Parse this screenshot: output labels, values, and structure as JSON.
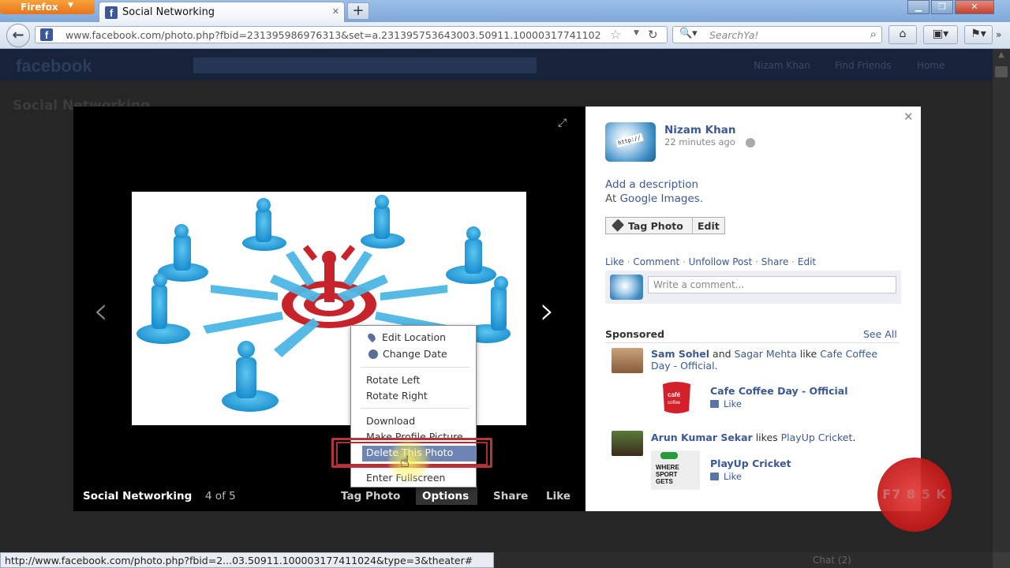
{
  "browser": {
    "app_button": "Firefox",
    "tab_title": "Social Networking",
    "url": "www.facebook.com/photo.php?fbid=231395986976313&set=a.231395753643003.50911.10000317741102",
    "search_placeholder": "SearchYa!",
    "status_url": "http://www.facebook.com/photo.php?fbid=2...03.50911.100003177411024&type=3&theater#"
  },
  "fb_background": {
    "logo": "facebook",
    "user_name": "Nizam Khan",
    "find_friends": "Find Friends",
    "home": "Home",
    "page_title": "Social Networking",
    "chat": "Chat (2)"
  },
  "theater": {
    "album_name": "Social Networking",
    "photo_count": "4 of 5",
    "actions": {
      "tag_photo": "Tag Photo",
      "options": "Options",
      "share": "Share",
      "like": "Like"
    },
    "menu": {
      "edit_location": "Edit Location",
      "change_date": "Change Date",
      "rotate_left": "Rotate Left",
      "rotate_right": "Rotate Right",
      "download": "Download",
      "make_profile_picture": "Make Profile Picture",
      "delete_photo": "Delete This Photo",
      "enter_fullscreen": "Enter Fullscreen"
    }
  },
  "panel": {
    "owner_name": "Nizam Khan",
    "posted_time": "22 minutes ago",
    "add_description": "Add a description",
    "at_prefix": "At ",
    "at_place": "Google Images.",
    "tag_photo_button": "Tag Photo",
    "edit_button": "Edit",
    "actions": [
      "Like",
      "Comment",
      "Unfollow Post",
      "Share",
      "Edit"
    ],
    "comment_placeholder": "Write a comment...",
    "sponsored_label": "Sponsored",
    "see_all": "See All",
    "sponsored": [
      {
        "people": "Sam Sohel",
        "and_text": " and ",
        "people2": "Sagar Mehta",
        "like_text": " like ",
        "page": "Cafe Coffee Day - Official",
        "page_end": ".",
        "ad_name": "Cafe Coffee Day - Official",
        "ad_like": "Like"
      },
      {
        "people": "Arun Kumar Sekar",
        "like_text": " likes ",
        "page": "PlayUp Cricket",
        "page_end": ".",
        "ad_name": "PlayUp Cricket",
        "ad_like": "Like"
      }
    ]
  },
  "watermark": "F7 8 5 K",
  "colors": {
    "facebook_blue": "#3b5998",
    "menu_highlight": "#6d84b4",
    "callout_red": "#b9333a"
  }
}
